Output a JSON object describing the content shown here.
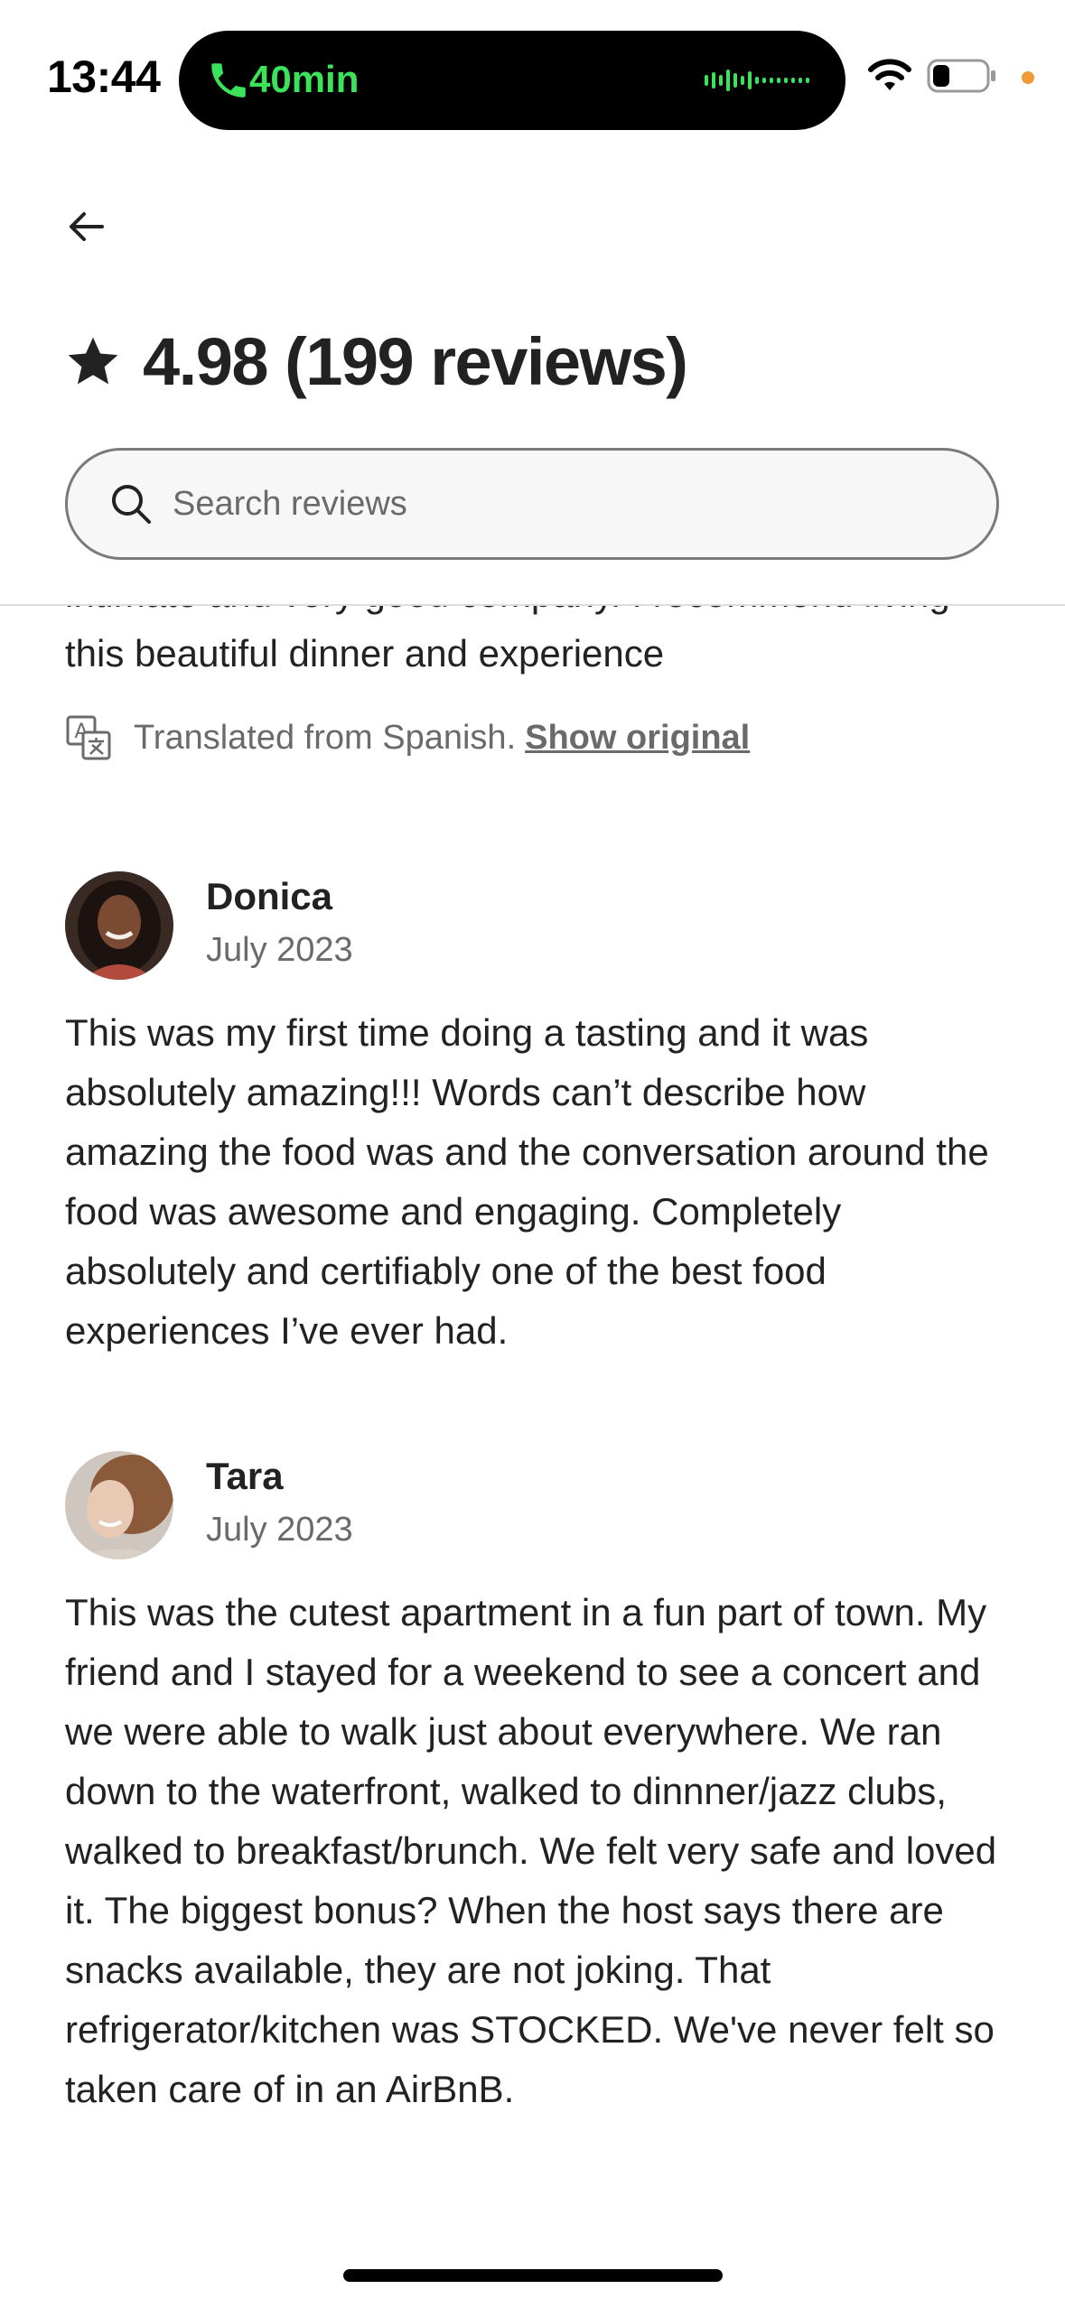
{
  "status_bar": {
    "time": "13:44",
    "call_duration": "40min",
    "accent_call": "#3be35a",
    "icons": [
      "phone-icon",
      "waveform-icon",
      "wifi-icon",
      "battery-icon"
    ]
  },
  "header": {
    "back_icon": "arrow-left-icon",
    "rating_icon": "star-icon",
    "rating_text": "4.98 (199 reviews)"
  },
  "search": {
    "placeholder": "Search reviews",
    "icon": "search-icon"
  },
  "partial_review": {
    "text": "intimate and very good company. I recommend living this beautiful dinner and experience",
    "translation_note": "Translated from Spanish.",
    "show_original": "Show original"
  },
  "reviews": [
    {
      "name": "Donica",
      "date": "July 2023",
      "text": "This was my first time doing a tasting and it was absolutely amazing!!! Words can’t describe how amazing the food was and the conversation around the food was awesome and engaging. Completely absolutely and certifiably one of the best food experiences I’ve ever had."
    },
    {
      "name": "Tara",
      "date": "July 2023",
      "text": "This was the cutest apartment in a fun part of town.  My friend and I stayed for a weekend to see a concert and we were able to walk just about everywhere.  We ran down to the waterfront, walked to dinnner/jazz clubs, walked to breakfast/brunch.  We felt very safe and loved it.  The biggest bonus?  When the host says there are snacks available, they are not joking.  That refrigerator/kitchen was STOCKED.  We've never felt so taken care of in an AirBnB."
    }
  ]
}
